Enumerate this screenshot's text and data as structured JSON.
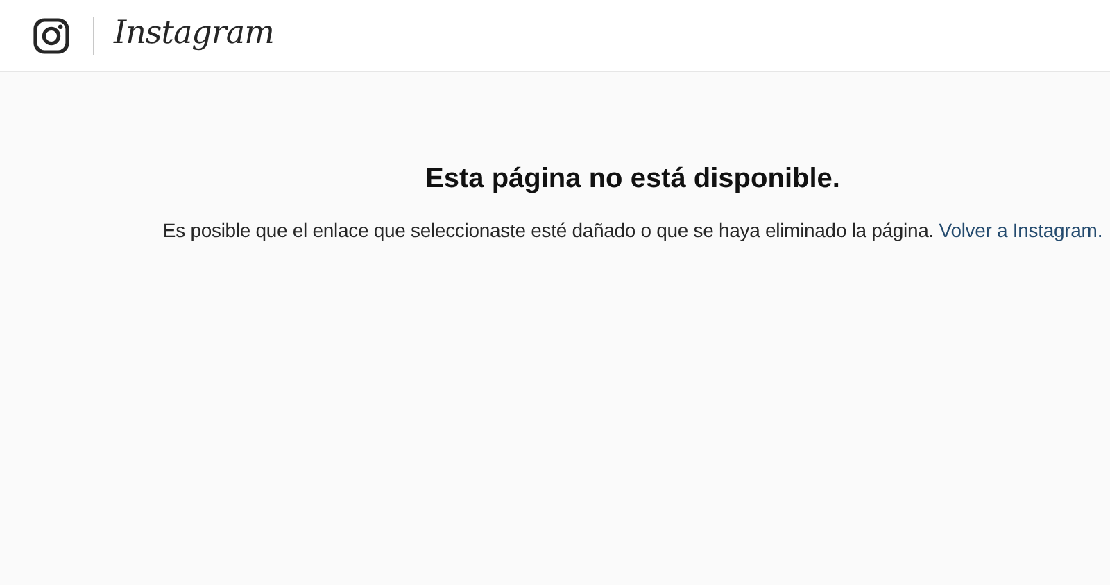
{
  "header": {
    "logo_text": "Instagram"
  },
  "error": {
    "title": "Esta página no está disponible.",
    "message": "Es posible que el enlace que seleccionaste esté dañado o que se haya eliminado la página.",
    "link": "Volver a Instagram."
  }
}
